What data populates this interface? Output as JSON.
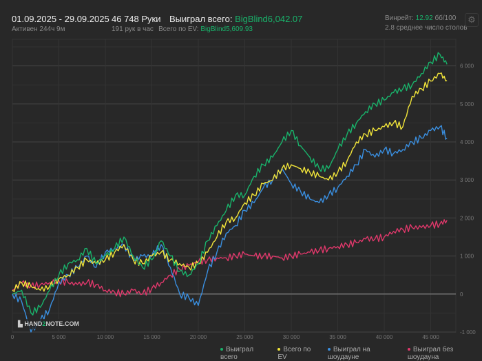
{
  "header": {
    "date_range": "01.09.2025 - 29.09.2025",
    "active": "Активен 244ч 9м",
    "hands": "46 748 Руки",
    "hands_per_hour": "191 рук в час",
    "won_label": "Выиграл всего:",
    "won_value": "BigBlind6,042.07",
    "ev_label": "Всего по EV:",
    "ev_value": "BigBlind5,609.93",
    "winrate_label": "Винрейт:",
    "winrate_value": "12.92",
    "winrate_unit": "бб/100",
    "avg_tables": "2.8 среднее число столов"
  },
  "logo": "HAND2NOTE.COM",
  "colors": {
    "won": "#19b36b",
    "ev": "#f2e53a",
    "sd": "#3a8fe0",
    "nsd": "#e0386b"
  },
  "chart_data": {
    "type": "line",
    "xlim": [
      0,
      47700
    ],
    "ylim": [
      -1000,
      6700
    ],
    "x_ticks": [
      0,
      5000,
      10000,
      15000,
      20000,
      25000,
      30000,
      35000,
      40000,
      45000
    ],
    "x_tick_labels": [
      "0",
      "5 000",
      "10 000",
      "15 000",
      "20 000",
      "25 000",
      "30 000",
      "35 000",
      "40 000",
      "45 000"
    ],
    "y_ticks": [
      -1000,
      0,
      1000,
      2000,
      3000,
      4000,
      5000,
      6000
    ],
    "y_tick_labels": [
      "-1 000",
      "0",
      "1 000",
      "2 000",
      "3 000",
      "4 000",
      "5 000",
      "6 000"
    ],
    "legend_position": "bottom-right",
    "x": [
      0,
      1000,
      2000,
      3000,
      4000,
      5000,
      6000,
      7000,
      8000,
      9000,
      10000,
      11000,
      12000,
      13000,
      14000,
      15000,
      16000,
      17000,
      18000,
      19000,
      20000,
      21000,
      22000,
      23000,
      24000,
      25000,
      26000,
      27000,
      28000,
      29000,
      30000,
      31000,
      32000,
      33000,
      34000,
      35000,
      36000,
      37000,
      38000,
      39000,
      40000,
      41000,
      42000,
      43000,
      44000,
      45000,
      46000,
      46748
    ],
    "series": [
      {
        "name": "Выиграл всего",
        "key": "won",
        "values": [
          0,
          100,
          -500,
          -350,
          100,
          500,
          800,
          900,
          1200,
          800,
          1000,
          1200,
          1500,
          1000,
          700,
          900,
          1400,
          1000,
          600,
          500,
          800,
          1400,
          1800,
          2200,
          2600,
          2600,
          3100,
          3400,
          3600,
          4000,
          4300,
          3900,
          3600,
          3300,
          3300,
          3800,
          4200,
          4500,
          4800,
          5000,
          5100,
          5300,
          5400,
          5500,
          5800,
          6100,
          6300,
          6042
        ]
      },
      {
        "name": "Всего по EV",
        "key": "ev",
        "values": [
          100,
          300,
          200,
          100,
          200,
          400,
          500,
          700,
          900,
          800,
          900,
          1100,
          1300,
          900,
          800,
          1000,
          1100,
          900,
          800,
          700,
          800,
          1100,
          1500,
          1900,
          2000,
          2400,
          2600,
          2900,
          3000,
          3300,
          3400,
          3300,
          3200,
          3100,
          3000,
          3200,
          3500,
          4000,
          4200,
          4300,
          4400,
          4500,
          4400,
          5200,
          5400,
          5600,
          5800,
          5610
        ]
      },
      {
        "name": "Выиграл на шоудауне",
        "key": "sd",
        "values": [
          0,
          -200,
          -1000,
          -700,
          -400,
          300,
          500,
          700,
          1000,
          700,
          1100,
          1200,
          1300,
          900,
          1000,
          1000,
          1300,
          700,
          0,
          -100,
          -300,
          600,
          1100,
          1600,
          1800,
          2200,
          2400,
          2800,
          3000,
          3300,
          2900,
          2700,
          2500,
          2400,
          2600,
          2800,
          3100,
          3400,
          3800,
          3600,
          3800,
          3700,
          3800,
          4000,
          4100,
          4300,
          4400,
          4100
        ]
      },
      {
        "name": "Выиграл без шоудауна",
        "key": "nsd",
        "values": [
          100,
          300,
          200,
          250,
          300,
          350,
          300,
          250,
          300,
          250,
          100,
          50,
          0,
          100,
          0,
          150,
          300,
          500,
          650,
          750,
          850,
          900,
          950,
          950,
          1000,
          1050,
          1000,
          1000,
          1000,
          950,
          1000,
          1050,
          1100,
          1150,
          1200,
          1250,
          1300,
          1350,
          1450,
          1450,
          1500,
          1650,
          1700,
          1750,
          1750,
          1800,
          1850,
          1940
        ]
      }
    ]
  }
}
